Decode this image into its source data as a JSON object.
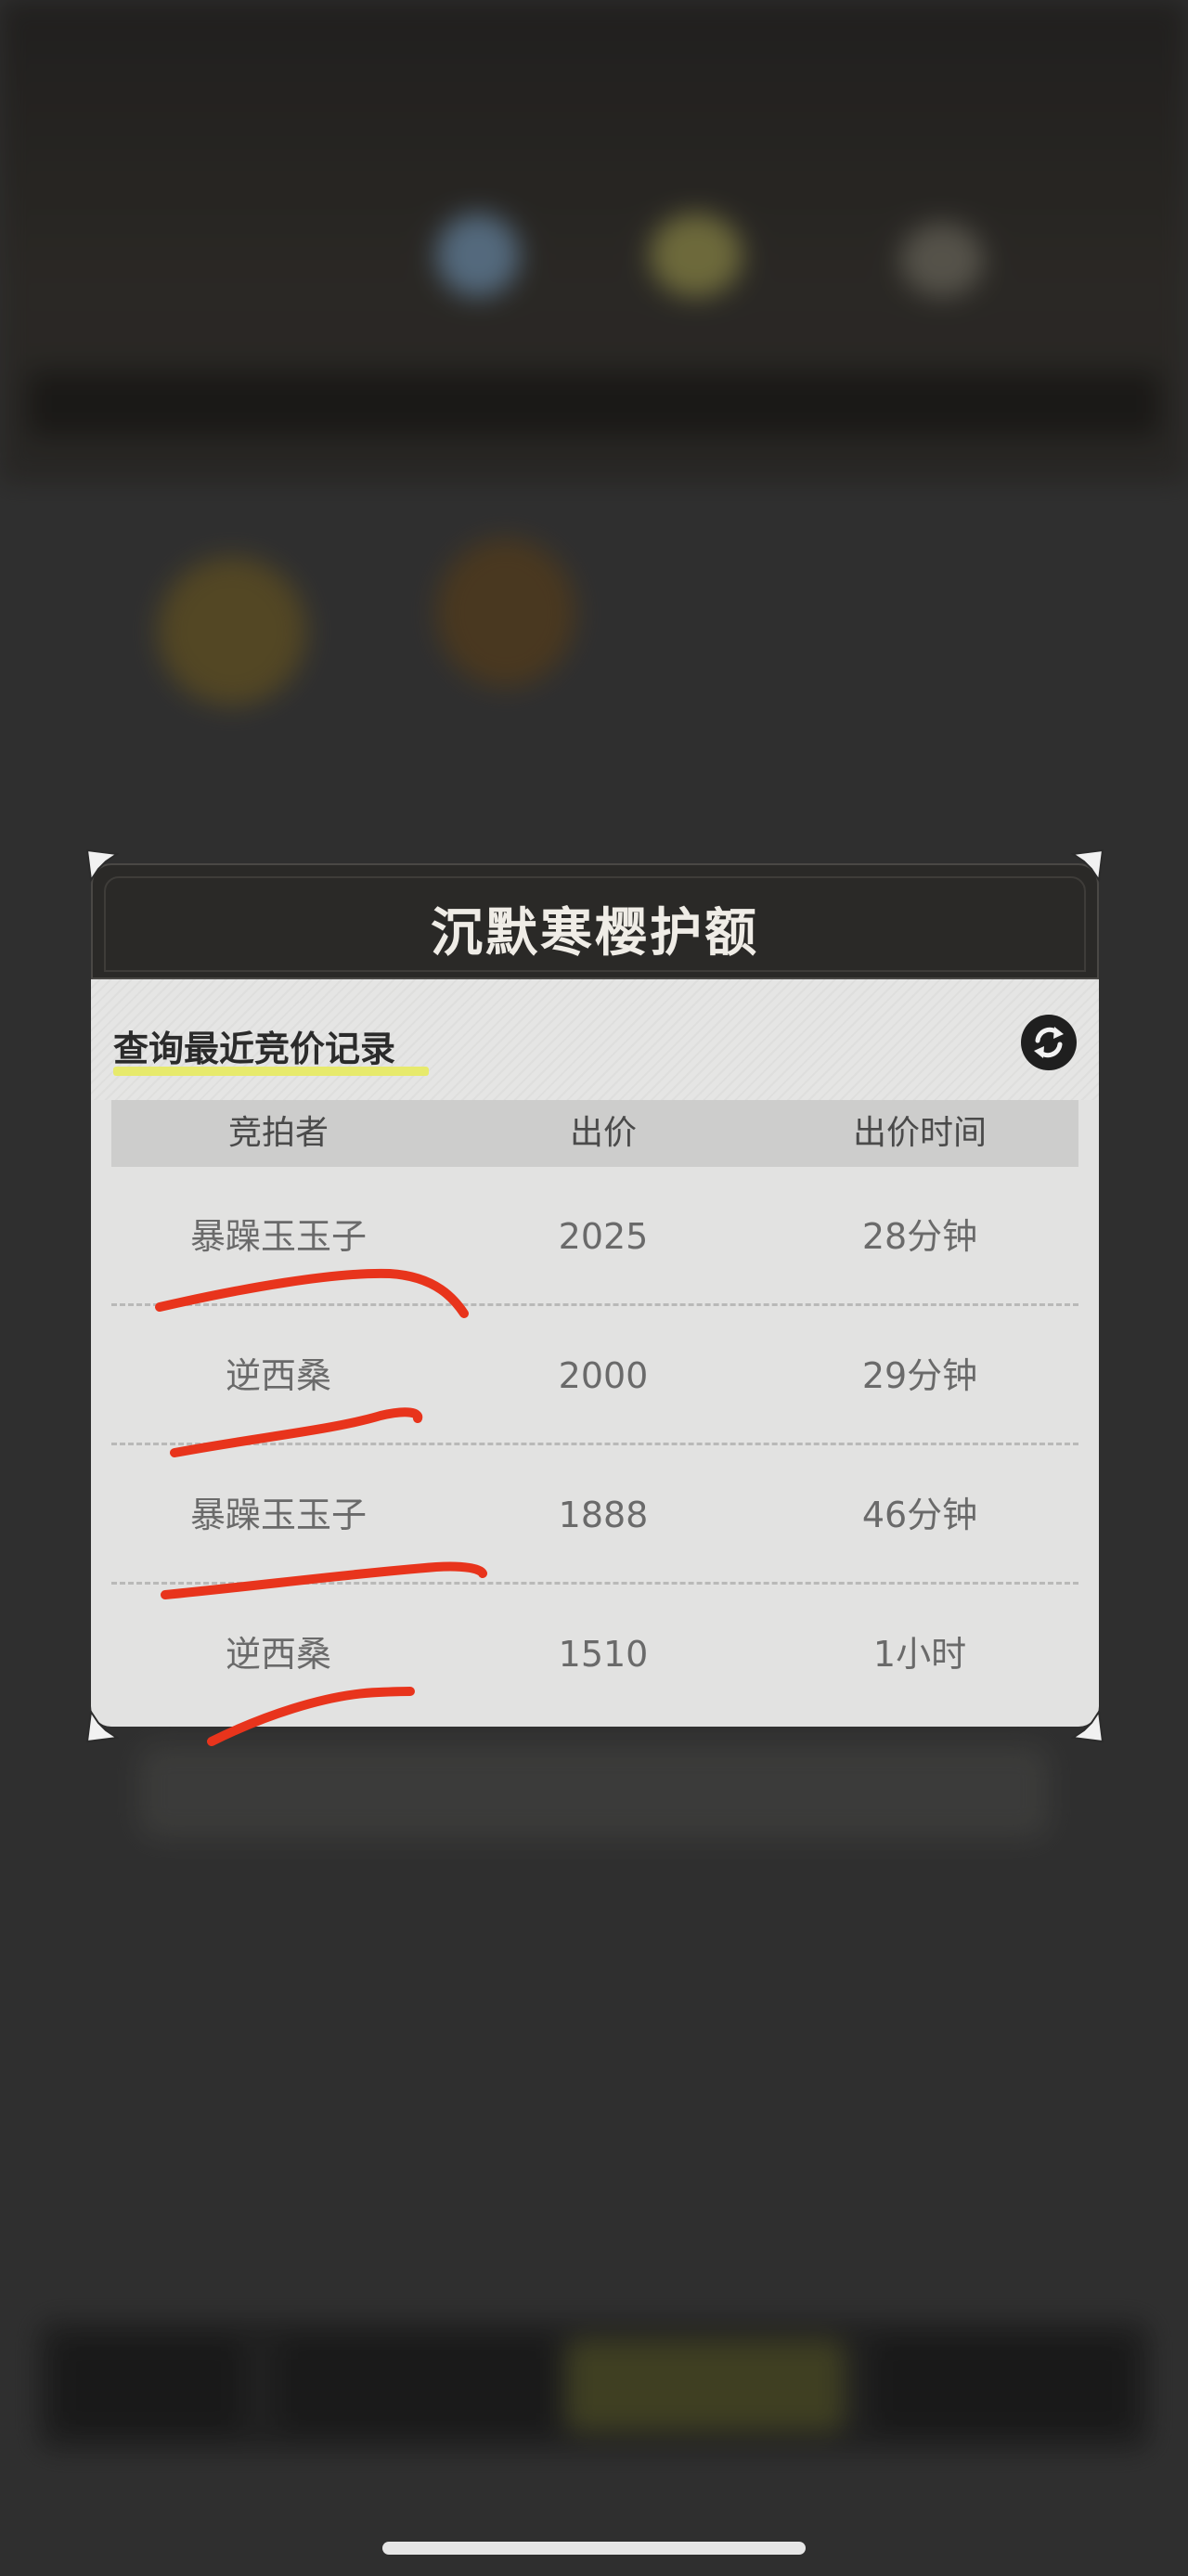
{
  "dialog": {
    "title": "沉默寒樱护额",
    "query_title": "查询最近竞价记录",
    "columns": [
      "竞拍者",
      "出价",
      "出价时间"
    ],
    "rows": [
      {
        "bidder": "暴躁玉玉子",
        "price": "2025",
        "time": "28分钟"
      },
      {
        "bidder": "逆西桑",
        "price": "2000",
        "time": "29分钟"
      },
      {
        "bidder": "暴躁玉玉子",
        "price": "1888",
        "time": "46分钟"
      },
      {
        "bidder": "逆西桑",
        "price": "1510",
        "time": "1小时"
      }
    ],
    "icons": {
      "refresh": "refresh-icon",
      "corners": "corner-ornament-icon"
    }
  },
  "colors": {
    "header_bg": "#2a2927",
    "body_bg": "#e2e2e1",
    "title_text": "#efece6",
    "underline_accent": "#e7ea6c",
    "scribble_red": "#e8341c"
  }
}
